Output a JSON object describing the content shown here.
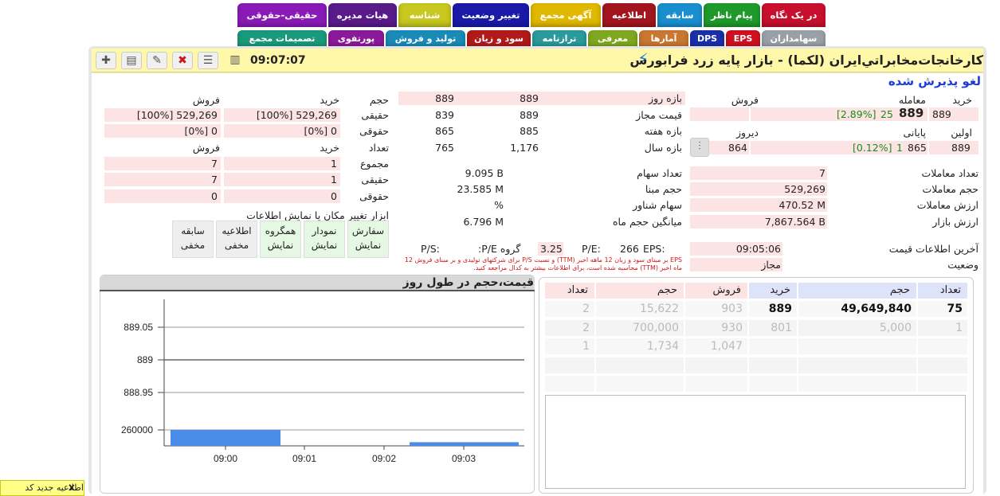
{
  "tabs_row1": [
    {
      "label": "در یک نگاه",
      "color": "#c8102e"
    },
    {
      "label": "پیام ناظر",
      "color": "#1e9a2a"
    },
    {
      "label": "سابقه",
      "color": "#1a8fd0"
    },
    {
      "label": "اطلاعیه",
      "color": "#a2151f"
    },
    {
      "label": "آگهی مجمع",
      "color": "#e0b800"
    },
    {
      "label": "تغییر وضعیت",
      "color": "#1a1aa8"
    },
    {
      "label": "شناسه",
      "color": "#c8c820"
    },
    {
      "label": "هیات مدیره",
      "color": "#5a1a8a"
    },
    {
      "label": "حقیقی-حقوقی",
      "color": "#8a1ab8"
    }
  ],
  "tabs_row2": [
    {
      "label": "سهامداران",
      "color": "#9aa0a6"
    },
    {
      "label": "EPS",
      "color": "#d01020"
    },
    {
      "label": "DPS",
      "color": "#1a2fa8"
    },
    {
      "label": "آمارها",
      "color": "#c87830"
    },
    {
      "label": "معرفی",
      "color": "#7fa820"
    },
    {
      "label": "ترازنامه",
      "color": "#2a9a9a"
    },
    {
      "label": "سود و زیان",
      "color": "#b01a1a"
    },
    {
      "label": "تولید و فروش",
      "color": "#1a8ab8"
    },
    {
      "label": "پورتفوی",
      "color": "#8a1a9a"
    },
    {
      "label": "تصمیمات مجمع",
      "color": "#1a9a7a"
    }
  ],
  "header": {
    "time": "09:07:07",
    "title": "كارخانجات‌مخابراتي‌ايران (لكما) - بازار پایه زرد فرابورس",
    "status_banner": "لغو پذیرش شده"
  },
  "trade_box": {
    "h_buy": "خرید",
    "h_trade": "معامله",
    "h_sell": "فروش",
    "buy": "889",
    "last": "889",
    "last_change": "25",
    "last_pct": "[2.89%]",
    "h_first": "اولین",
    "h_final": "پایانی",
    "h_yesterday": "دیروز",
    "first": "889",
    "final": "865",
    "final_change": "1",
    "final_pct": "[0.12%]",
    "yesterday": "864"
  },
  "range_box": {
    "rows": [
      {
        "label": "بازه روز",
        "a": "889",
        "b": "889"
      },
      {
        "label": "قیمت مجاز",
        "a": "889",
        "b": "839"
      },
      {
        "label": "بازه هفته",
        "a": "885",
        "b": "865"
      },
      {
        "label": "بازه سال",
        "a": "1,176",
        "b": "765"
      }
    ]
  },
  "client_box": {
    "h_vol": "حجم",
    "h_buy": "خرید",
    "h_sell": "فروش",
    "real_label": "حقیقی",
    "real_buy": "[100%] 529,269",
    "real_sell": "[100%] 529,269",
    "legal_label": "حقوقی",
    "legal_buy": "[0%] 0",
    "legal_sell": "[0%] 0",
    "h_count": "تعداد",
    "h_buy2": "خرید",
    "h_sell2": "فروش",
    "total_label": "مجموع",
    "total_buy": "1",
    "total_sell": "7",
    "real2_label": "حقیقی",
    "real2_buy": "1",
    "real2_sell": "7",
    "legal2_label": "حقوقی",
    "legal2_buy": "0",
    "legal2_sell": "0"
  },
  "stats_left": [
    {
      "label": "تعداد معاملات",
      "value": "7"
    },
    {
      "label": "حجم معاملات",
      "value": "529,269"
    },
    {
      "label": "ارزش معاملات",
      "value": "470.52 M"
    },
    {
      "label": "ارزش بازار",
      "value": "7,867.564 B"
    }
  ],
  "stats_mid": [
    {
      "label": "تعداد سهام",
      "value": "9.095 B"
    },
    {
      "label": "حجم مبنا",
      "value": "23.585 M"
    },
    {
      "label": "سهام شناور",
      "value": "%"
    },
    {
      "label": "میانگین حجم ماه",
      "value": "6.796 M"
    }
  ],
  "tools": {
    "title": "ابزار تغییر مکان یا نمایش اطلاعات",
    "items": [
      {
        "label": "سفارش",
        "state": "نمایش",
        "color": "#e4f8e4"
      },
      {
        "label": "نمودار",
        "state": "نمایش",
        "color": "#e4f8e4"
      },
      {
        "label": "همگروه",
        "state": "نمایش",
        "color": "#e4f8e4"
      },
      {
        "label": "اطلاعیه",
        "state": "مخفی",
        "color": "#eeeeee"
      },
      {
        "label": "سابقه",
        "state": "مخفی",
        "color": "#eeeeee"
      }
    ]
  },
  "ratios": {
    "eps_label": "EPS:",
    "eps": "266",
    "pe_label": "P/E:",
    "pe": "3.25",
    "gpe_label": "گروه P/E:",
    "ps_label": "P/S:",
    "note": "EPS بر مبنای سود و زیان 12 ماهه اخیر (TTM) و نسبت P/S برای شرکتهای تولیدی و بر مبنای فروش 12 ماه اخیر (TTM) محاسبه شده است، برای اطلاعات بیشتر به کدال مراجعه کنید."
  },
  "last_info": {
    "label": "آخرین اطلاعات قیمت",
    "value": "09:05:06",
    "status_label": "وضعیت",
    "status": "مجاز"
  },
  "chart_data": {
    "type": "bar",
    "title": "قیمت،حجم در طول روز",
    "x": [
      "09:00",
      "09:01",
      "09:02",
      "09:03"
    ],
    "y_ticks": [
      "889.05",
      "889",
      "888.95",
      "260000"
    ],
    "ylim_price": [
      888.95,
      889.05
    ],
    "volume_series": [
      {
        "name": "",
        "values": [
          260000,
          0,
          0,
          60000
        ]
      }
    ],
    "grid": true
  },
  "orderbook": {
    "headers": [
      "تعداد",
      "حجم",
      "خرید",
      "فروش",
      "حجم",
      "تعداد"
    ],
    "rows": [
      {
        "bcount": "75",
        "bvol": "49,649,840",
        "bprice": "889",
        "sprice": "903",
        "svol": "15,622",
        "scount": "2"
      },
      {
        "bcount": "1",
        "bvol": "5,000",
        "bprice": "801",
        "sprice": "930",
        "svol": "700,000",
        "scount": "2"
      },
      {
        "bcount": "",
        "bvol": "",
        "bprice": "",
        "sprice": "1,047",
        "svol": "1,734",
        "scount": "1"
      },
      {
        "bcount": "",
        "bvol": "",
        "bprice": "",
        "sprice": "",
        "svol": "",
        "scount": ""
      },
      {
        "bcount": "",
        "bvol": "",
        "bprice": "",
        "sprice": "",
        "svol": "",
        "scount": ""
      }
    ]
  },
  "toast": {
    "close": "x",
    "text": "اطلاعیه جدید کد"
  }
}
